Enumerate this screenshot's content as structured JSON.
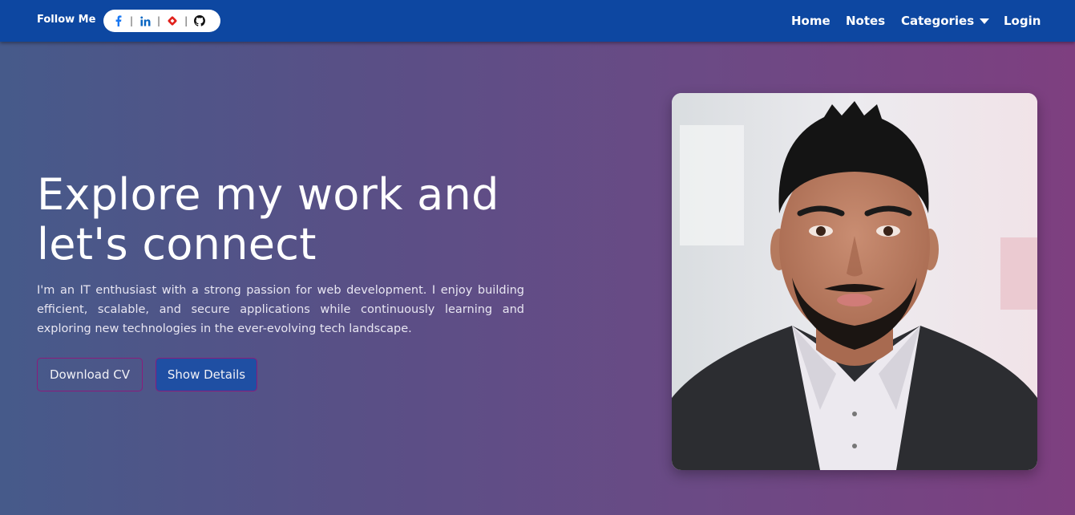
{
  "navbar": {
    "follow_label": "Follow Me",
    "social_icons": [
      "facebook-icon",
      "linkedin-icon",
      "badge-icon",
      "github-icon"
    ],
    "links": {
      "home": "Home",
      "notes": "Notes",
      "categories": "Categories",
      "login": "Login"
    }
  },
  "hero": {
    "title": "Explore my work and let's connect",
    "description": "I'm an IT enthusiast with a strong passion for web development. I enjoy building efficient, scalable, and secure applications while continuously learning and exploring new technologies in the ever-evolving tech landscape.",
    "download_cv_label": "Download CV",
    "show_details_label": "Show Details"
  },
  "colors": {
    "navbar": "#0d47a1",
    "button_border": "#8a1c7c",
    "show_details_bg": "#1f4fa3",
    "facebook": "#1877f2",
    "linkedin": "#0a66c2",
    "badge": "#e0201b"
  }
}
